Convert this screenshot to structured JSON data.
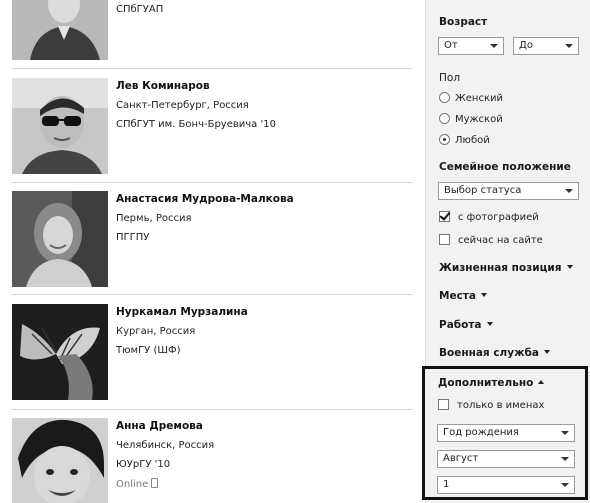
{
  "results": [
    {
      "name": "",
      "city": "",
      "university": "СПбГУАП",
      "online": ""
    },
    {
      "name": "Лев Коминаров",
      "city": "Санкт-Петербург, Россия",
      "university": "СПбГУТ им. Бонч-Бруевича '10",
      "online": ""
    },
    {
      "name": "Анастасия Мудрова-Малкова",
      "city": "Пермь, Россия",
      "university": "ПГГПУ",
      "online": ""
    },
    {
      "name": "Нуркамал Мурзалина",
      "city": "Курган, Россия",
      "university": "ТюмГУ (ШФ)",
      "online": ""
    },
    {
      "name": "Анна Дремова",
      "city": "Челябинск, Россия",
      "university": "ЮУрГУ '10",
      "online": "Online"
    }
  ],
  "filters": {
    "age": {
      "title": "Возраст",
      "from": "От",
      "to": "До"
    },
    "gender": {
      "title": "Пол",
      "options": [
        "Женский",
        "Мужской",
        "Любой"
      ],
      "selected": "Любой"
    },
    "marital": {
      "title": "Семейное положение",
      "value": "Выбор статуса"
    },
    "with_photo": {
      "label": "с фотографией",
      "checked": true
    },
    "online_now": {
      "label": "сейчас на сайте",
      "checked": false
    },
    "life_position": "Жизненная позиция",
    "places": "Места",
    "work": "Работа",
    "military": "Военная служба",
    "extra": {
      "title": "Дополнительно",
      "names_only": {
        "label": "только в именах",
        "checked": false
      },
      "birth_year": "Год рождения",
      "birth_month": "Август",
      "birth_day": "1"
    }
  }
}
